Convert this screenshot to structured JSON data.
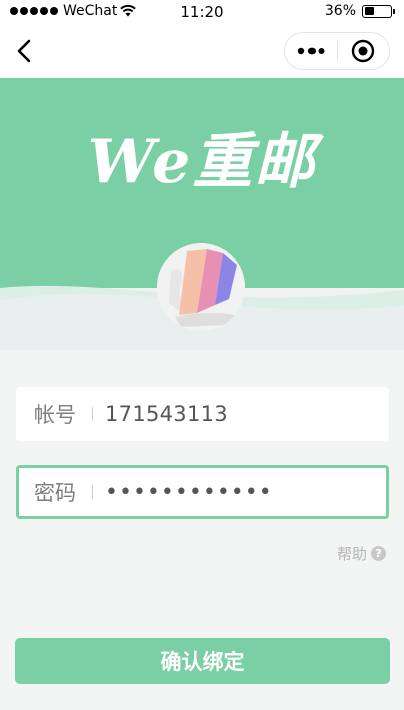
{
  "statusbar": {
    "carrier": "WeChat",
    "time": "11:20",
    "battery_text": "36%",
    "battery_level": 0.36
  },
  "navbar": {
    "back_icon": "chevron-left-icon",
    "more_icon": "more-dots-icon",
    "close_icon": "target-circle-icon"
  },
  "hero": {
    "logo_text": "We重邮",
    "colors": {
      "wave": "#7bcfa4",
      "wave_light": "#d8ece4"
    }
  },
  "form": {
    "account": {
      "label": "帐号",
      "value": "171543113"
    },
    "password": {
      "label": "密码",
      "value": "••••••••••••"
    },
    "help_text": "帮助",
    "help_icon": "question-circle-icon",
    "submit_label": "确认绑定"
  },
  "theme": {
    "accent": "#7bcfa4"
  }
}
